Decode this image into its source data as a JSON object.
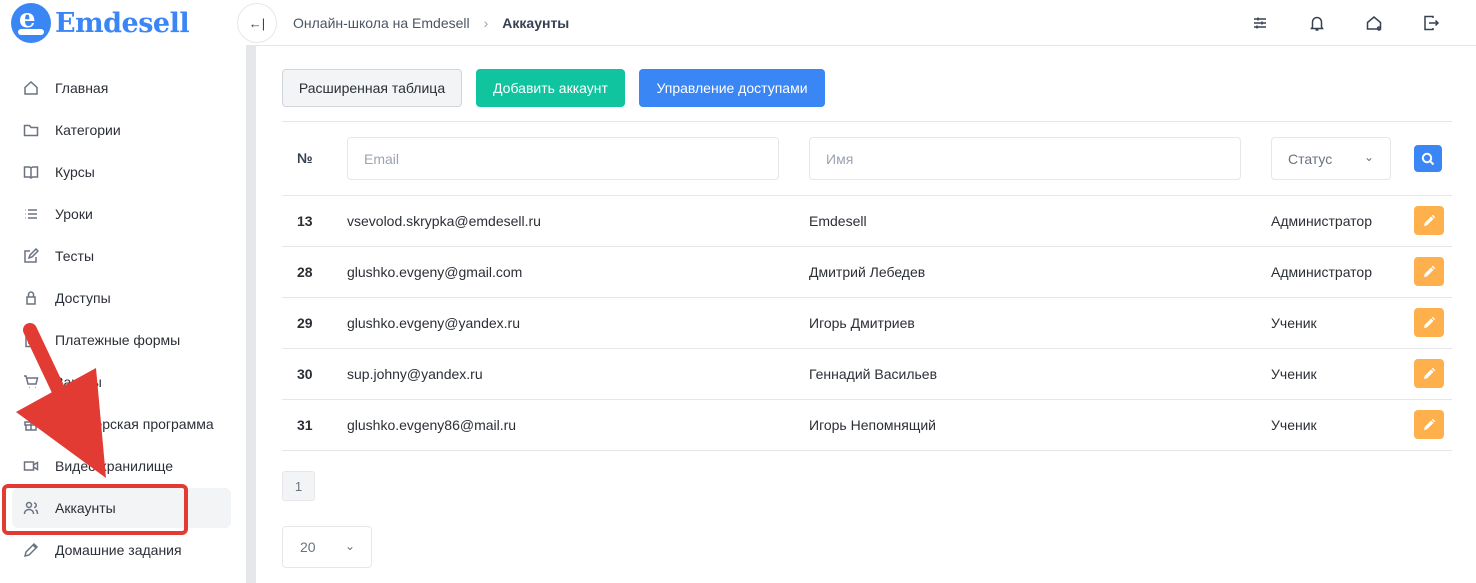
{
  "app": {
    "brand": "Emdesell"
  },
  "header": {
    "breadcrumb": [
      "Онлайн-школа на Emdesell",
      "Аккаунты"
    ],
    "icons": [
      "collapse-sidebar-icon",
      "sliders-icon",
      "bell-icon",
      "home-icon",
      "logout-icon"
    ]
  },
  "sidebar": {
    "items": [
      {
        "label": "Главная",
        "icon": "home-icon"
      },
      {
        "label": "Категории",
        "icon": "folder-icon"
      },
      {
        "label": "Курсы",
        "icon": "book-icon"
      },
      {
        "label": "Уроки",
        "icon": "list-icon"
      },
      {
        "label": "Тесты",
        "icon": "edit-square-icon"
      },
      {
        "label": "Доступы",
        "icon": "lock-icon"
      },
      {
        "label": "Платежные формы",
        "icon": "calculator-icon"
      },
      {
        "label": "Заказы",
        "icon": "cart-icon"
      },
      {
        "label": "Партнерская программа",
        "icon": "gift-icon"
      },
      {
        "label": "Видео хранилище",
        "icon": "video-icon"
      },
      {
        "label": "Аккаунты",
        "icon": "users-icon",
        "active": true
      },
      {
        "label": "Домашние задания",
        "icon": "pencil-icon"
      }
    ]
  },
  "toolbar": {
    "extended_table": "Расширенная таблица",
    "add_account": "Добавить аккаунт",
    "manage_access": "Управление доступами"
  },
  "filters": {
    "number_label": "№",
    "email_placeholder": "Email",
    "name_placeholder": "Имя",
    "status_value": "Статус"
  },
  "table": {
    "rows": [
      {
        "id": "13",
        "email": "vsevolod.skrypka@emdesell.ru",
        "name": "Emdesell",
        "status": "Администратор"
      },
      {
        "id": "28",
        "email": "glushko.evgeny@gmail.com",
        "name": "Дмитрий Лебедев",
        "status": "Администратор"
      },
      {
        "id": "29",
        "email": "glushko.evgeny@yandex.ru",
        "name": "Игорь Дмитриев",
        "status": "Ученик"
      },
      {
        "id": "30",
        "email": "sup.johny@yandex.ru",
        "name": "Геннадий Васильев",
        "status": "Ученик"
      },
      {
        "id": "31",
        "email": "glushko.evgeny86@mail.ru",
        "name": "Игорь Непомнящий",
        "status": "Ученик"
      }
    ]
  },
  "pagination": {
    "current_page": "1",
    "per_page": "20"
  },
  "colors": {
    "accent": "#3a86f5",
    "green": "#10c4a0",
    "edit": "#fdb04c",
    "annotation": "#e23b33"
  }
}
